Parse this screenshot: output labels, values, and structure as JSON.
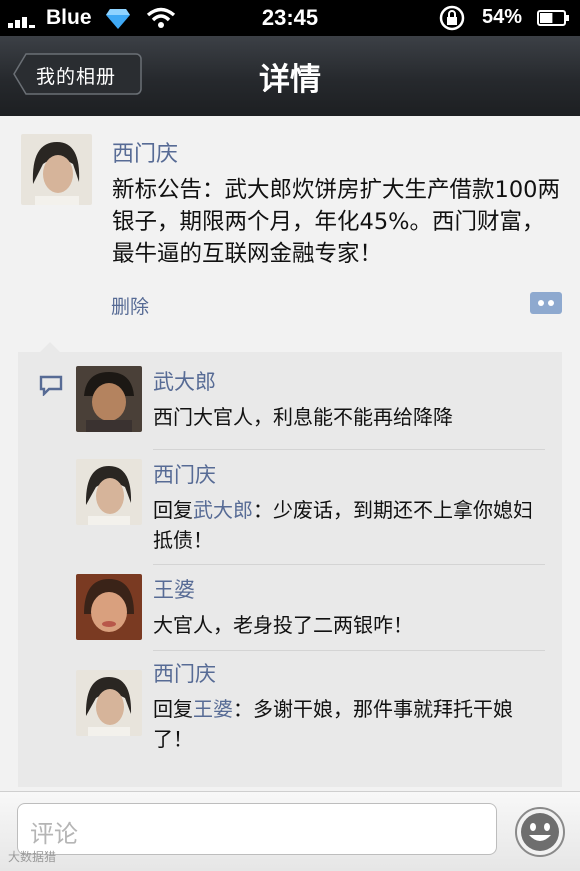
{
  "status": {
    "carrier": "Blue",
    "time": "23:45",
    "battery": "54%",
    "battery_level": 0.54
  },
  "nav": {
    "back_label": "我的相册",
    "title": "详情"
  },
  "post": {
    "author": "西门庆",
    "text": "新标公告：武大郎炊饼房扩大生产借款100两银子，期限两个月，年化45%。西门财富，最牛逼的互联网金融专家！",
    "delete_label": "删除"
  },
  "comments": [
    {
      "author": "武大郎",
      "reply_prefix": "",
      "reply_to": "",
      "text": "西门大官人，利息能不能再给降降"
    },
    {
      "author": "西门庆",
      "reply_prefix": "回复",
      "reply_to": "武大郎",
      "text": "：少废话，到期还不上拿你媳妇抵债！"
    },
    {
      "author": "王婆",
      "reply_prefix": "",
      "reply_to": "",
      "text": "大官人，老身投了二两银咋！"
    },
    {
      "author": "西门庆",
      "reply_prefix": "回复",
      "reply_to": "王婆",
      "text": "：多谢干娘，那件事就拜托干娘了！"
    }
  ],
  "input": {
    "placeholder": "评论"
  },
  "watermark": "大数据猎",
  "colors": {
    "link": "#576b95",
    "navbar": "#2b2e32"
  },
  "icons": [
    "signal-icon",
    "diamond-icon",
    "wifi-icon",
    "rotation-lock-icon",
    "battery-icon",
    "back-arrow-icon",
    "more-icon",
    "comment-bubble-icon",
    "emoji-icon"
  ]
}
